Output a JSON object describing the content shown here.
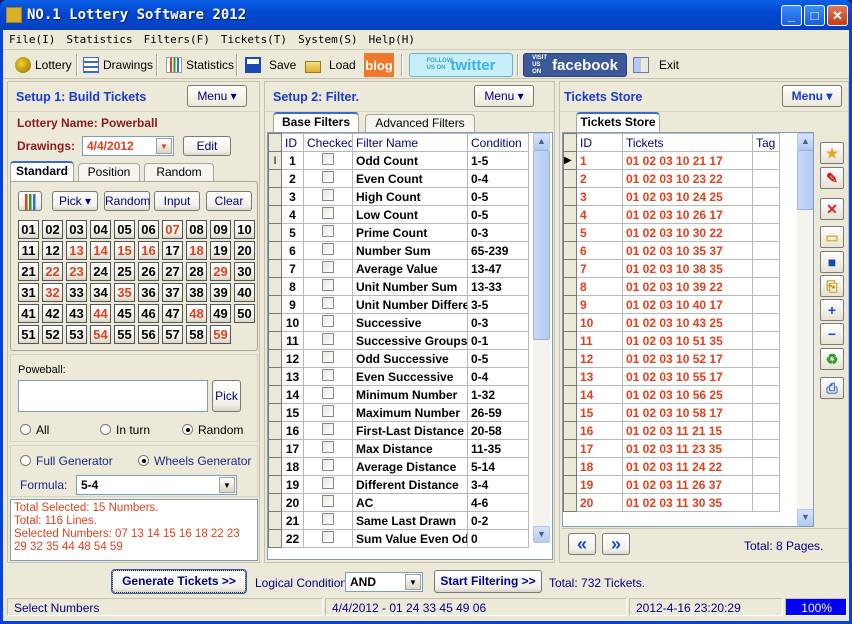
{
  "window": {
    "title": "NO.1 Lottery Software 2012",
    "buttons": {
      "minimize": "_",
      "maximize": "□",
      "close": "✕"
    }
  },
  "menu": [
    "File(I)",
    "Statistics",
    "Filters(F)",
    "Tickets(T)",
    "System(S)",
    "Help(H)"
  ],
  "toolbar": {
    "lottery": "Lottery",
    "drawings": "Drawings",
    "statistics": "Statistics",
    "save": "Save",
    "load": "Load",
    "blog": "blog",
    "twitter_small": "FOLLOW US ON",
    "twitter": "twitter",
    "facebook_small": "VISIT US ON",
    "facebook": "facebook",
    "exit": "Exit"
  },
  "setup1": {
    "title": "Setup 1: Build  Tickets",
    "menu_label": "Menu ▾",
    "lottery_label": "Lottery  Name: Powerball",
    "drawings_label": "Drawings:",
    "drawings_value": "4/4/2012",
    "edit_label": "Edit",
    "tabs": [
      "Standard",
      "Position",
      "Random"
    ],
    "actions": {
      "pick": "Pick ▾",
      "random": "Random",
      "input": "Input",
      "clear": "Clear"
    },
    "numbers": [
      "01",
      "02",
      "03",
      "04",
      "05",
      "06",
      "07",
      "08",
      "09",
      "10",
      "11",
      "12",
      "13",
      "14",
      "15",
      "16",
      "17",
      "18",
      "19",
      "20",
      "21",
      "22",
      "23",
      "24",
      "25",
      "26",
      "27",
      "28",
      "29",
      "30",
      "31",
      "32",
      "33",
      "34",
      "35",
      "36",
      "37",
      "38",
      "39",
      "40",
      "41",
      "42",
      "43",
      "44",
      "45",
      "46",
      "47",
      "48",
      "49",
      "50",
      "51",
      "52",
      "53",
      "54",
      "55",
      "56",
      "57",
      "58",
      "59"
    ],
    "selected": [
      "07",
      "13",
      "14",
      "15",
      "16",
      "18",
      "22",
      "23",
      "29",
      "32",
      "35",
      "44",
      "48",
      "54",
      "59"
    ],
    "powerball_label": "Poweball:",
    "powerball_value": "",
    "pick_label": "Pick",
    "pb_mode": [
      {
        "label": "All",
        "checked": false
      },
      {
        "label": "In turn",
        "checked": false
      },
      {
        "label": "Random",
        "checked": true
      }
    ],
    "generator": [
      {
        "label": "Full Generator",
        "checked": false
      },
      {
        "label": "Wheels Generator",
        "checked": true
      }
    ],
    "formula_label": "Formula:",
    "formula_value": "5-4",
    "summary": [
      "Total Selected: 15 Numbers.",
      "Total: 116 Lines.",
      "Selected Numbers: 07 13 14 15 16 18 22 23 29 32 35 44 48 54 59"
    ]
  },
  "setup2": {
    "title": "Setup 2: Filter.",
    "menu_label": "Menu ▾",
    "tabs": [
      "Base Filters",
      "Advanced Filters"
    ],
    "columns": [
      "ID",
      "Checked",
      "Filter Name",
      "Condition"
    ],
    "rows": [
      {
        "id": "1",
        "checked": false,
        "name": "Odd Count",
        "cond": "1-5"
      },
      {
        "id": "2",
        "checked": false,
        "name": "Even Count",
        "cond": "0-4"
      },
      {
        "id": "3",
        "checked": false,
        "name": "High Count",
        "cond": "0-5"
      },
      {
        "id": "4",
        "checked": false,
        "name": "Low Count",
        "cond": "0-5"
      },
      {
        "id": "5",
        "checked": false,
        "name": "Prime Count",
        "cond": "0-3"
      },
      {
        "id": "6",
        "checked": false,
        "name": "Number Sum",
        "cond": "65-239"
      },
      {
        "id": "7",
        "checked": false,
        "name": "Average Value",
        "cond": "13-47"
      },
      {
        "id": "8",
        "checked": false,
        "name": "Unit Number Sum",
        "cond": "13-33"
      },
      {
        "id": "9",
        "checked": false,
        "name": "Unit Number Differe",
        "cond": "3-5"
      },
      {
        "id": "10",
        "checked": false,
        "name": "Successive",
        "cond": "0-3"
      },
      {
        "id": "11",
        "checked": false,
        "name": "Successive Groups",
        "cond": "0-1"
      },
      {
        "id": "12",
        "checked": false,
        "name": "Odd Successive",
        "cond": "0-5"
      },
      {
        "id": "13",
        "checked": false,
        "name": "Even Successive",
        "cond": "0-4"
      },
      {
        "id": "14",
        "checked": false,
        "name": "Minimum Number",
        "cond": "1-32"
      },
      {
        "id": "15",
        "checked": false,
        "name": "Maximum Number",
        "cond": "26-59"
      },
      {
        "id": "16",
        "checked": false,
        "name": "First-Last Distance",
        "cond": "20-58"
      },
      {
        "id": "17",
        "checked": false,
        "name": "Max Distance",
        "cond": "11-35"
      },
      {
        "id": "18",
        "checked": false,
        "name": "Average Distance",
        "cond": "5-14"
      },
      {
        "id": "19",
        "checked": false,
        "name": "Different Distance",
        "cond": "3-4"
      },
      {
        "id": "20",
        "checked": false,
        "name": "AC",
        "cond": "4-6"
      },
      {
        "id": "21",
        "checked": false,
        "name": "Same Last Drawn",
        "cond": "0-2"
      },
      {
        "id": "22",
        "checked": false,
        "name": "Sum Value Even Od",
        "cond": "0"
      }
    ]
  },
  "store": {
    "title": "Tickets Store",
    "menu_label": "Menu ▾",
    "tab": "Tickets Store",
    "columns": [
      "ID",
      "Tickets",
      "Tag"
    ],
    "rows": [
      {
        "id": "1",
        "ticket": "01 02 03 10 21 17",
        "tag": ""
      },
      {
        "id": "2",
        "ticket": "01 02 03 10 23 22",
        "tag": ""
      },
      {
        "id": "3",
        "ticket": "01 02 03 10 24 25",
        "tag": ""
      },
      {
        "id": "4",
        "ticket": "01 02 03 10 26 17",
        "tag": ""
      },
      {
        "id": "5",
        "ticket": "01 02 03 10 30 22",
        "tag": ""
      },
      {
        "id": "6",
        "ticket": "01 02 03 10 35 37",
        "tag": ""
      },
      {
        "id": "7",
        "ticket": "01 02 03 10 38 35",
        "tag": ""
      },
      {
        "id": "8",
        "ticket": "01 02 03 10 39 22",
        "tag": ""
      },
      {
        "id": "9",
        "ticket": "01 02 03 10 40 17",
        "tag": ""
      },
      {
        "id": "10",
        "ticket": "01 02 03 10 43 25",
        "tag": ""
      },
      {
        "id": "11",
        "ticket": "01 02 03 10 51 35",
        "tag": ""
      },
      {
        "id": "12",
        "ticket": "01 02 03 10 52 17",
        "tag": ""
      },
      {
        "id": "13",
        "ticket": "01 02 03 10 55 17",
        "tag": ""
      },
      {
        "id": "14",
        "ticket": "01 02 03 10 56 25",
        "tag": ""
      },
      {
        "id": "15",
        "ticket": "01 02 03 10 58 17",
        "tag": ""
      },
      {
        "id": "16",
        "ticket": "01 02 03 11 21 15",
        "tag": ""
      },
      {
        "id": "17",
        "ticket": "01 02 03 11 23 35",
        "tag": ""
      },
      {
        "id": "18",
        "ticket": "01 02 03 11 24 22",
        "tag": ""
      },
      {
        "id": "19",
        "ticket": "01 02 03 11 26 37",
        "tag": ""
      },
      {
        "id": "20",
        "ticket": "01 02 03 11 30 35",
        "tag": ""
      }
    ],
    "side_icons": [
      "star-folder-icon",
      "clean-brush-icon",
      "delete-icon",
      "open-folder-icon",
      "save-icon",
      "copy-icon",
      "add-icon",
      "remove-icon",
      "recycle-icon",
      "print-icon"
    ],
    "prev_label": "«",
    "next_label": "»",
    "pages_label": "Total: 8 Pages."
  },
  "bottom": {
    "generate_label": "Generate Tickets >>",
    "logic_label": "Logical Condition:",
    "logic_value": "AND",
    "filter_label": "Start Filtering >>",
    "total_label": "Total: 732 Tickets."
  },
  "statusbar": {
    "hint": "Select Numbers",
    "last_draw": "4/4/2012 - 01 24 33 45 49 06",
    "datetime": "2012-4-16 23:20:29",
    "progress_text": "100%",
    "progress": 1.0
  },
  "colors": {
    "accent": "#1a3ad6",
    "selected": "#e0401c",
    "title_red": "#8b1a1a",
    "progress": "#0000ff"
  }
}
